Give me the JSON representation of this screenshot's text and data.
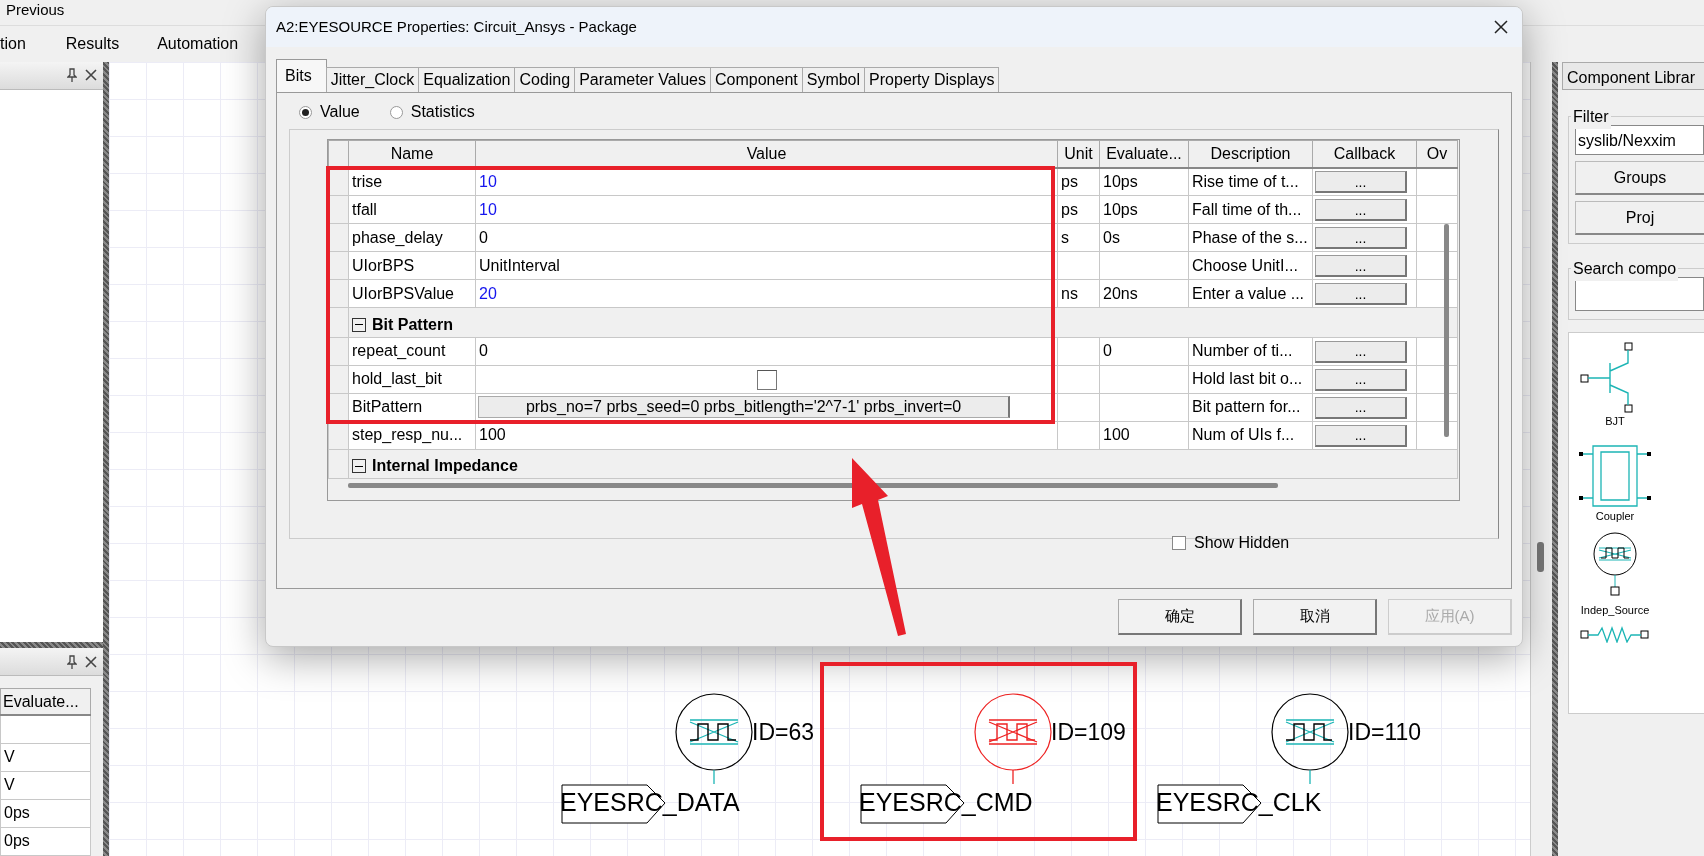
{
  "toolbar": [
    "Previous"
  ],
  "menu": [
    "tion",
    "Results",
    "Automation"
  ],
  "left_panel_bottom": {
    "column": "Evaluate...",
    "rows": [
      "V",
      "V",
      "0ps",
      "0ps"
    ]
  },
  "canvas": {
    "components": [
      {
        "id": "ID=63",
        "port": "EYESRC_DATA",
        "selected": false
      },
      {
        "id": "ID=109",
        "port": "EYESRC_CMD",
        "selected": true
      },
      {
        "id": "ID=110",
        "port": "EYESRC_CLK",
        "selected": false
      }
    ]
  },
  "dialog": {
    "title": "A2:EYESOURCE Properties: Circuit_Ansys - Package",
    "tabs": [
      {
        "label": "Bits",
        "selected": true
      },
      {
        "label": "Jitter_Clock",
        "selected": false
      },
      {
        "label": "Equalization",
        "selected": false
      },
      {
        "label": "Coding",
        "selected": false
      },
      {
        "label": "Parameter Values",
        "selected": false
      },
      {
        "label": "Component",
        "selected": false
      },
      {
        "label": "Symbol",
        "selected": false
      },
      {
        "label": "Property Displays",
        "selected": false
      }
    ],
    "radios": [
      {
        "label": "Value",
        "selected": true
      },
      {
        "label": "Statistics",
        "selected": false
      }
    ],
    "table": {
      "columns": [
        "Name",
        "Value",
        "Unit",
        "Evaluate...",
        "Description",
        "Callback",
        "Ov"
      ],
      "rows": [
        {
          "kind": "text",
          "name": "trise",
          "value": "10",
          "edited": true,
          "unit": "ps",
          "evaluated": "10ps",
          "description": "Rise time of t...",
          "callback": "..."
        },
        {
          "kind": "text",
          "name": "tfall",
          "value": "10",
          "edited": true,
          "unit": "ps",
          "evaluated": "10ps",
          "description": "Fall time of th...",
          "callback": "..."
        },
        {
          "kind": "text",
          "name": "phase_delay",
          "value": "0",
          "edited": false,
          "unit": "s",
          "evaluated": "0s",
          "description": "Phase of the s...",
          "callback": "..."
        },
        {
          "kind": "text",
          "name": "UIorBPS",
          "value": "UnitInterval",
          "edited": false,
          "description": "Choose UnitI...",
          "callback": "..."
        },
        {
          "kind": "text",
          "name": "UIorBPSValue",
          "value": "20",
          "edited": true,
          "unit": "ns",
          "evaluated": "20ns",
          "description": "Enter a value ...",
          "callback": "..."
        },
        {
          "kind": "group",
          "name": "Bit Pattern",
          "expanded": true
        },
        {
          "kind": "text",
          "name": "repeat_count",
          "value": "0",
          "edited": false,
          "evaluated": "0",
          "description": "Number of ti...",
          "callback": "..."
        },
        {
          "kind": "checkbox",
          "name": "hold_last_bit",
          "checked": false,
          "description": "Hold last bit o...",
          "callback": "..."
        },
        {
          "kind": "button",
          "name": "BitPattern",
          "value": "prbs_no=7 prbs_seed=0 prbs_bitlength='2^7-1' prbs_invert=0",
          "description": "Bit pattern for...",
          "callback": "..."
        },
        {
          "kind": "text",
          "name": "step_resp_nu...",
          "value": "100",
          "edited": false,
          "evaluated": "100",
          "description": "Num of UIs f...",
          "callback": "..."
        },
        {
          "kind": "group",
          "name": "Internal Impedance",
          "expanded": true
        }
      ]
    },
    "show_hidden": {
      "label": "Show Hidden",
      "checked": false
    },
    "buttons": [
      {
        "label": "确定",
        "disabled": false
      },
      {
        "label": "取消",
        "disabled": false
      },
      {
        "label": "应用(A)",
        "disabled": true
      }
    ]
  },
  "component_library": {
    "title": "Component Librar",
    "filter_label": "Filter",
    "filter_value": "syslib/Nexxim",
    "buttons": [
      "Groups",
      "Proj"
    ],
    "search_label": "Search compo",
    "items": [
      {
        "kind": "bjt",
        "label": "BJT"
      },
      {
        "kind": "coupler",
        "label": "Coupler"
      },
      {
        "kind": "source",
        "label": "Indep_Source"
      },
      {
        "kind": "resistor"
      }
    ]
  }
}
